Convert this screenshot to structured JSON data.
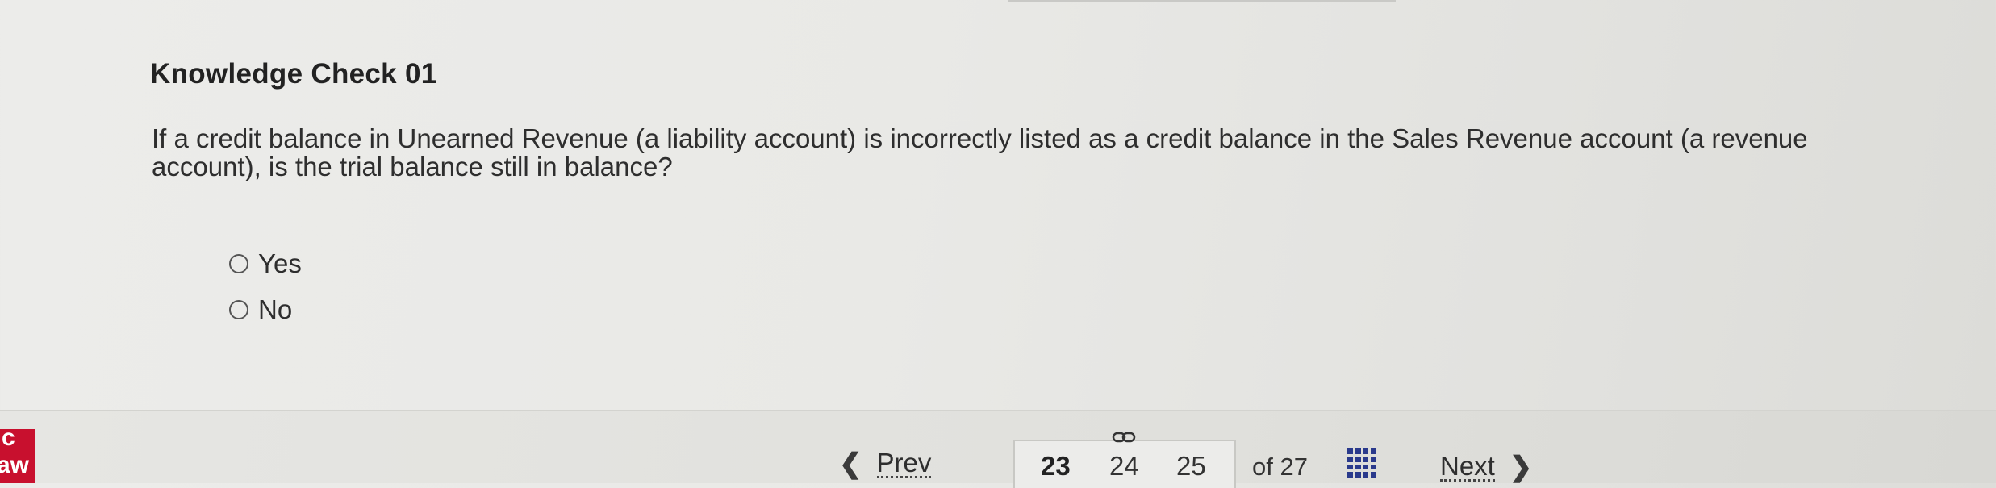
{
  "question": {
    "title": "Knowledge Check 01",
    "text": "If a credit balance in Unearned Revenue (a liability account) is incorrectly listed as a credit balance in the Sales Revenue account (a revenue account), is the trial balance still in balance?",
    "options": [
      {
        "label": "Yes",
        "selected": false
      },
      {
        "label": "No",
        "selected": false
      }
    ]
  },
  "footer": {
    "brand_top": "c",
    "brand_bottom": "aw",
    "prev_label": "Prev",
    "next_label": "Next",
    "pages": [
      "23",
      "24",
      "25"
    ],
    "current_page": "23",
    "of_total": "of 27",
    "icons": {
      "prev": "chevron-left-icon",
      "next": "chevron-right-icon",
      "link": "link-icon",
      "grid": "grid-icon"
    },
    "colors": {
      "brand": "#c8102e",
      "grid_icon": "#2a3a8c"
    }
  }
}
